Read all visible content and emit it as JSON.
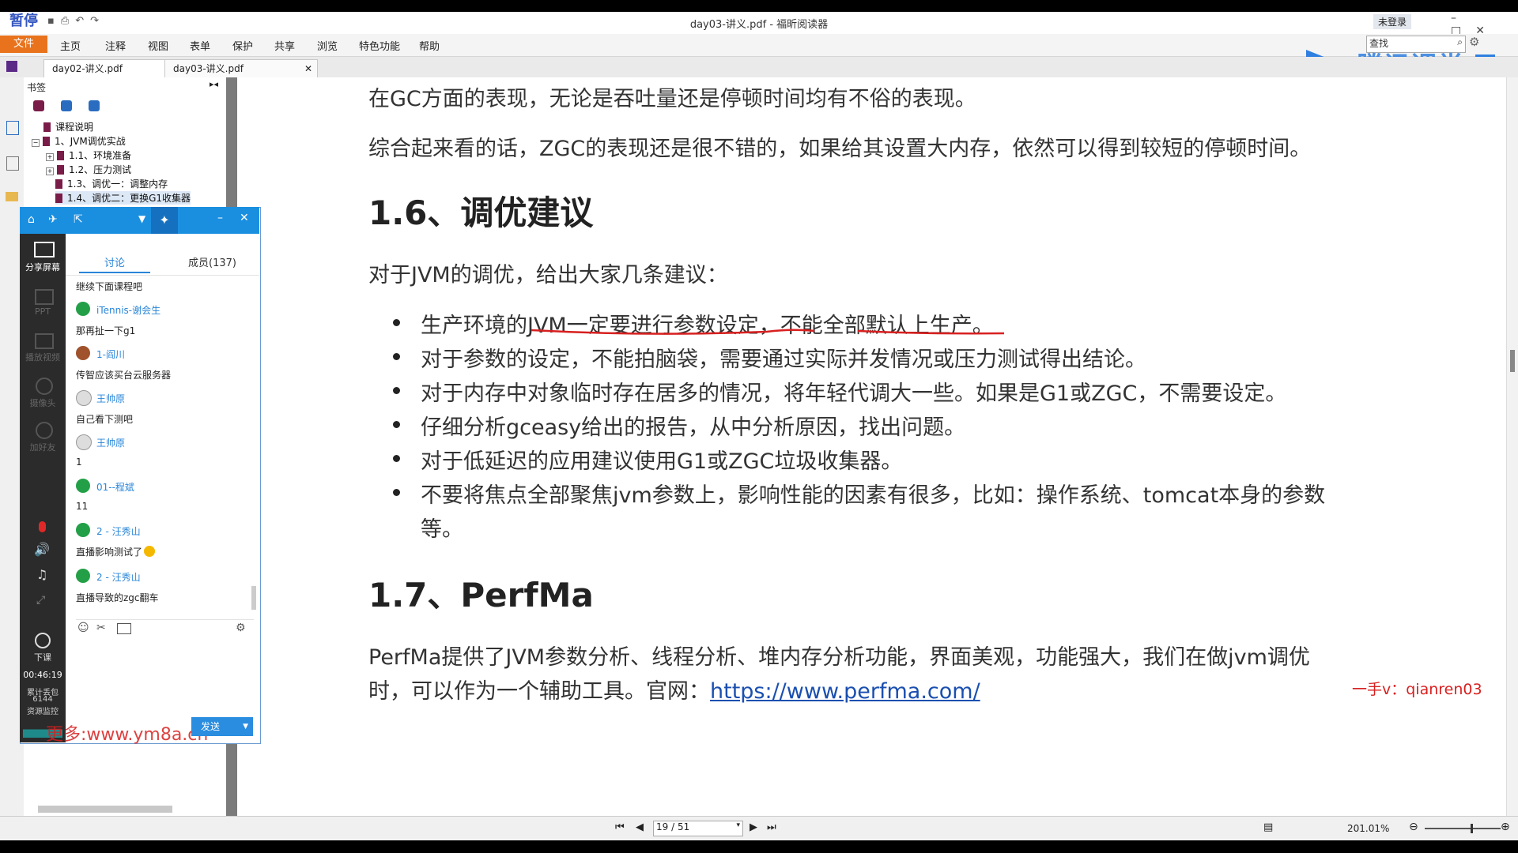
{
  "app": {
    "window_title": "day03-讲义.pdf - 福昕阅读器",
    "corner_text": "暂停",
    "login": "未登录",
    "search_placeholder": "查找",
    "tx_brand": "腾讯课堂",
    "tx_suffix": "辑器"
  },
  "menu": [
    "文件",
    "主页",
    "注释",
    "视图",
    "表单",
    "保护",
    "共享",
    "浏览",
    "特色功能",
    "帮助"
  ],
  "tabs": [
    "day02-讲义.pdf",
    "day03-讲义.pdf"
  ],
  "bookmarks": {
    "header": "书签",
    "items": [
      "课程说明",
      "1、JVM调优实战",
      "1.1、环境准备",
      "1.2、压力测试",
      "1.3、调优一：调整内存",
      "1.4、调优二：更换G1收集器"
    ]
  },
  "content": {
    "p1": "在GC方面的表现，无论是吞吐量还是停顿时间均有不俗的表现。",
    "p2": "综合起来看的话，ZGC的表现还是很不错的，如果给其设置大内存，依然可以得到较短的停顿时间。",
    "h16": "1.6、调优建议",
    "p3": "对于JVM的调优，给出大家几条建议：",
    "bullets": [
      "生产环境的JVM一定要进行参数设定，不能全部默认上生产。",
      "对于参数的设定，不能拍脑袋，需要通过实际并发情况或压力测试得出结论。",
      "对于内存中对象临时存在居多的情况，将年轻代调大一些。如果是G1或ZGC，不需要设定。",
      "仔细分析gceasy给出的报告，从中分析原因，找出问题。",
      "对于低延迟的应用建议使用G1或ZGC垃圾收集器。",
      "不要将焦点全部聚焦jvm参数上，影响性能的因素有很多，比如：操作系统、tomcat本身的参数",
      "等。"
    ],
    "h17": "1.7、PerfMa",
    "p4a": "PerfMa提供了JVM参数分析、线程分析、堆内存分析功能，界面美观，功能强大，我们在做jvm调优",
    "p4b": "时，可以作为一个辅助工具。官网：",
    "link": "https://www.perfma.com/",
    "watermark_right": "一手v：qianren03",
    "watermark_left": "更多:www.ym8a.cn"
  },
  "chat": {
    "tab_discuss": "讨论",
    "tab_members": "成员(137)",
    "side": [
      "分享屏幕",
      "PPT",
      "播放视频",
      "摄像头",
      "加好友"
    ],
    "class_end": "下课",
    "timer": "00:46:19",
    "stats1": "累计丢包",
    "stats2": "6144",
    "stats3": "资源监控",
    "messages": [
      {
        "name": "",
        "text": "继续下面课程吧"
      },
      {
        "name": "iTennis-谢会生",
        "text": "那再扯一下g1"
      },
      {
        "name": "1-阎川",
        "text": "传智应该买台云服务器"
      },
      {
        "name": "王帅原",
        "text": "自己看下测吧"
      },
      {
        "name": "王帅原",
        "text": "1"
      },
      {
        "name": "01--程斌",
        "text": "11"
      },
      {
        "name": "2 - 汪秀山",
        "text": "直播影响测试了"
      },
      {
        "name": "2 - 汪秀山",
        "text": "直播导致的zgc翻车"
      }
    ],
    "send": "发送"
  },
  "status": {
    "page": "19 / 51",
    "zoom": "201.01%"
  }
}
